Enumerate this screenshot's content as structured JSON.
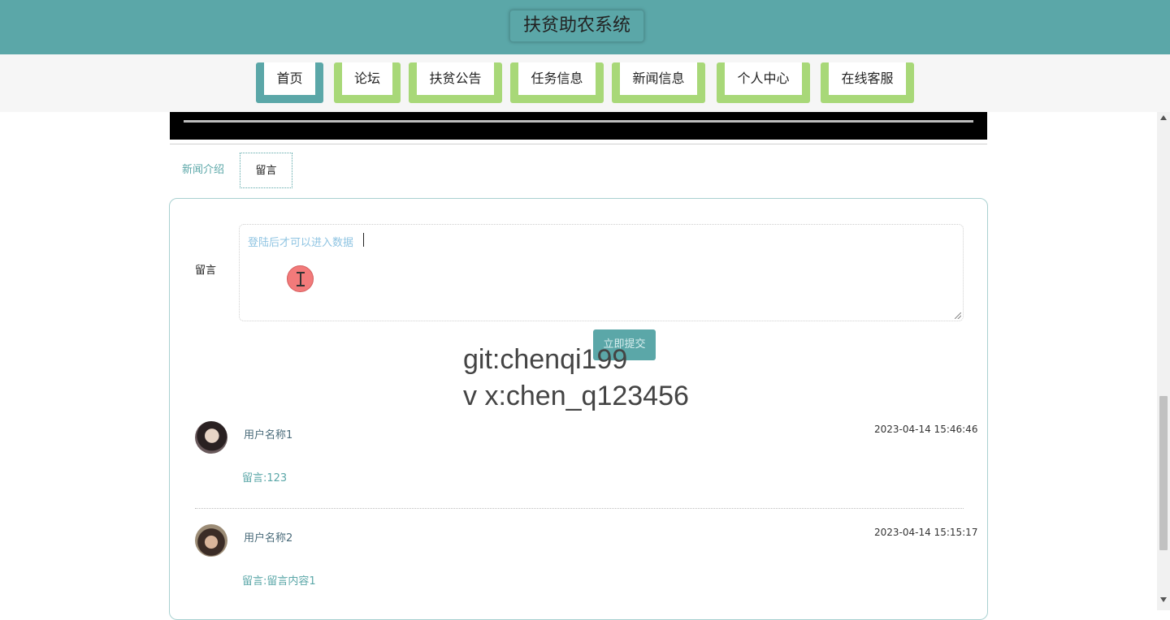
{
  "header": {
    "title": "扶贫助农系统"
  },
  "nav": {
    "items": [
      {
        "label": "首页"
      },
      {
        "label": "论坛"
      },
      {
        "label": "扶贫公告"
      },
      {
        "label": "任务信息"
      },
      {
        "label": "新闻信息"
      },
      {
        "label": "个人中心"
      },
      {
        "label": "在线客服"
      }
    ],
    "active": "首页"
  },
  "tabs": {
    "news_intro": "新闻介绍",
    "comment": "留言"
  },
  "form": {
    "label": "留言",
    "placeholder": "登陆后才可以进入数据",
    "submit": "立即提交"
  },
  "watermark": {
    "line1": "git:chenqi199",
    "line2": "v x:chen_q123456"
  },
  "comments": [
    {
      "user": "用户名称1",
      "time": "2023-04-14 15:46:46",
      "text": "留言:123"
    },
    {
      "user": "用户名称2",
      "time": "2023-04-14 15:15:17",
      "text": "留言:留言内容1"
    }
  ],
  "colors": {
    "primary": "#5ba7a8",
    "nav_accent": "#a8d878",
    "placeholder": "#8fc4e2"
  }
}
